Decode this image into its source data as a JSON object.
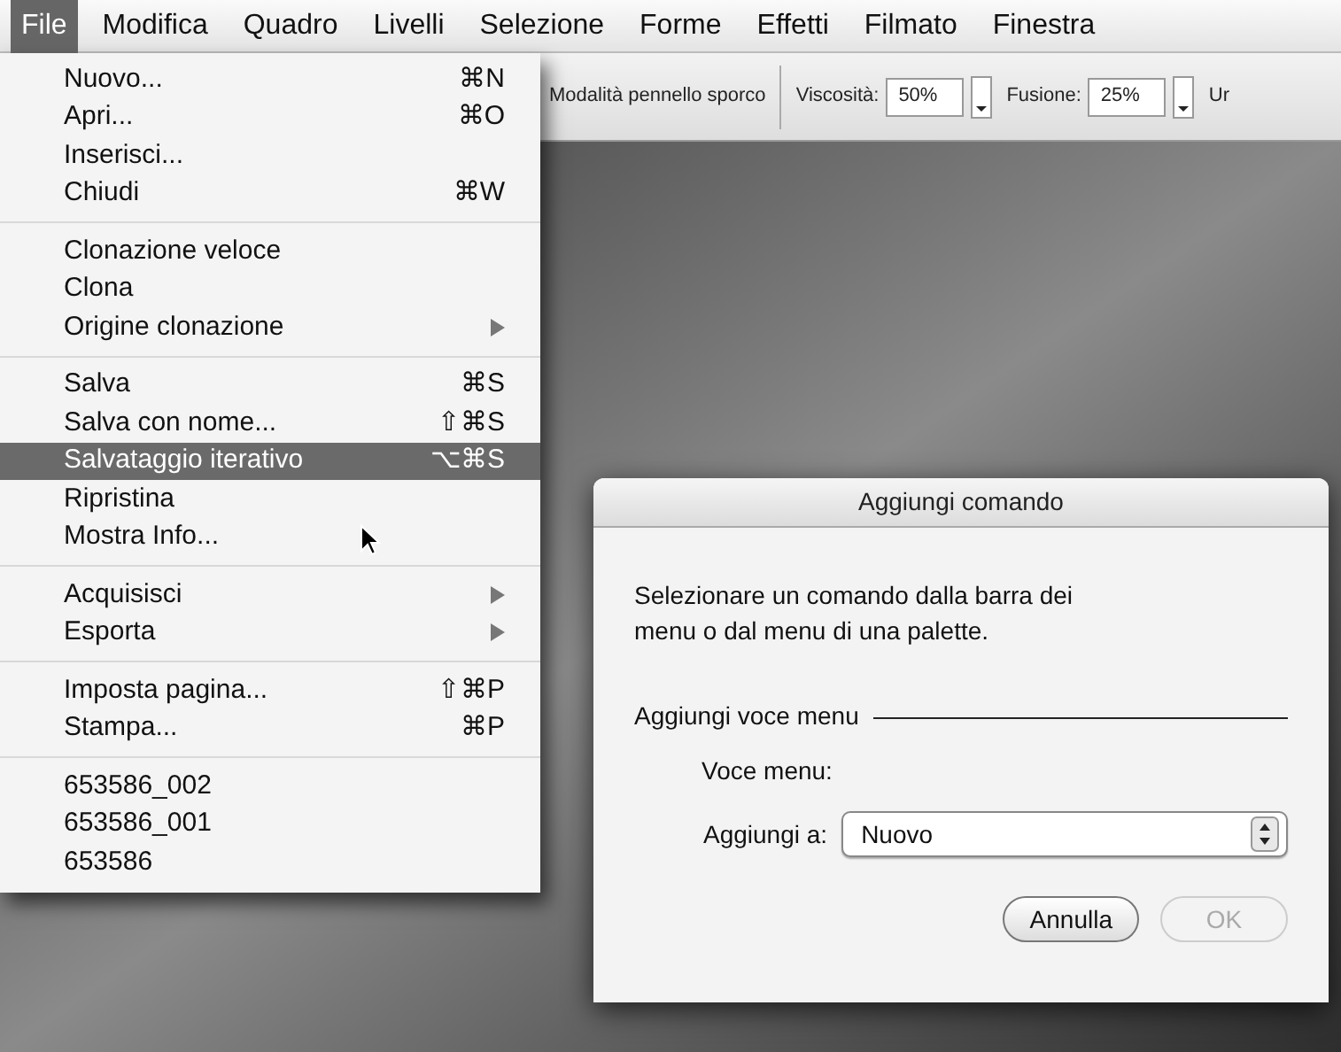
{
  "menubar": [
    {
      "label": "File",
      "selected": true
    },
    {
      "label": "Modifica",
      "selected": false
    },
    {
      "label": "Quadro",
      "selected": false
    },
    {
      "label": "Livelli",
      "selected": false
    },
    {
      "label": "Selezione",
      "selected": false
    },
    {
      "label": "Forme",
      "selected": false
    },
    {
      "label": "Effetti",
      "selected": false
    },
    {
      "label": "Filmato",
      "selected": false
    },
    {
      "label": "Finestra",
      "selected": false
    }
  ],
  "toolbar": {
    "mode_label": "Modalità pennello sporco",
    "fields": [
      {
        "label": "Viscosità:",
        "value": "50%"
      },
      {
        "label": "Fusione:",
        "value": "25%"
      }
    ],
    "cut_label": "Ur"
  },
  "file_menu": [
    [
      {
        "label": "Nuovo...",
        "shortcut": "⌘N",
        "kind": "command",
        "selected": false
      },
      {
        "label": "Apri...",
        "shortcut": "⌘O",
        "kind": "command",
        "selected": false
      },
      {
        "label": "Inserisci...",
        "kind": "command",
        "selected": false
      },
      {
        "label": "Chiudi",
        "shortcut": "⌘W",
        "kind": "command",
        "selected": false
      }
    ],
    [
      {
        "label": "Clonazione veloce",
        "kind": "command",
        "selected": false
      },
      {
        "label": "Clona",
        "kind": "command",
        "selected": false
      },
      {
        "label": "Origine clonazione",
        "kind": "submenu",
        "selected": false
      }
    ],
    [
      {
        "label": "Salva",
        "shortcut": "⌘S",
        "kind": "command",
        "selected": false
      },
      {
        "label": "Salva con nome...",
        "shortcut": "⇧⌘S",
        "kind": "command",
        "selected": false
      },
      {
        "label": "Salvataggio iterativo",
        "shortcut": "⌥⌘S",
        "kind": "command",
        "selected": true
      },
      {
        "label": "Ripristina",
        "kind": "command",
        "selected": false
      },
      {
        "label": "Mostra Info...",
        "kind": "command",
        "selected": false
      }
    ],
    [
      {
        "label": "Acquisisci",
        "kind": "submenu",
        "selected": false
      },
      {
        "label": "Esporta",
        "kind": "submenu",
        "selected": false
      }
    ],
    [
      {
        "label": "Imposta pagina...",
        "shortcut": "⇧⌘P",
        "kind": "command",
        "selected": false
      },
      {
        "label": "Stampa...",
        "shortcut": "⌘P",
        "kind": "command",
        "selected": false
      }
    ],
    [
      {
        "label": "653586_002",
        "kind": "command",
        "selected": false
      },
      {
        "label": "653586_001",
        "kind": "command",
        "selected": false
      },
      {
        "label": "653586",
        "kind": "command",
        "selected": false
      }
    ]
  ],
  "dialog": {
    "title": "Aggiungi comando",
    "message": "Selezionare un comando dalla barra dei menu o dal menu di una palette.",
    "section": "Aggiungi voce menu",
    "item_label": "Voce menu:",
    "add_to_label": "Aggiungi a:",
    "add_to_value": "Nuovo",
    "buttons": [
      {
        "label": "Annulla",
        "disabled": false
      },
      {
        "label": "OK",
        "disabled": true
      }
    ]
  }
}
